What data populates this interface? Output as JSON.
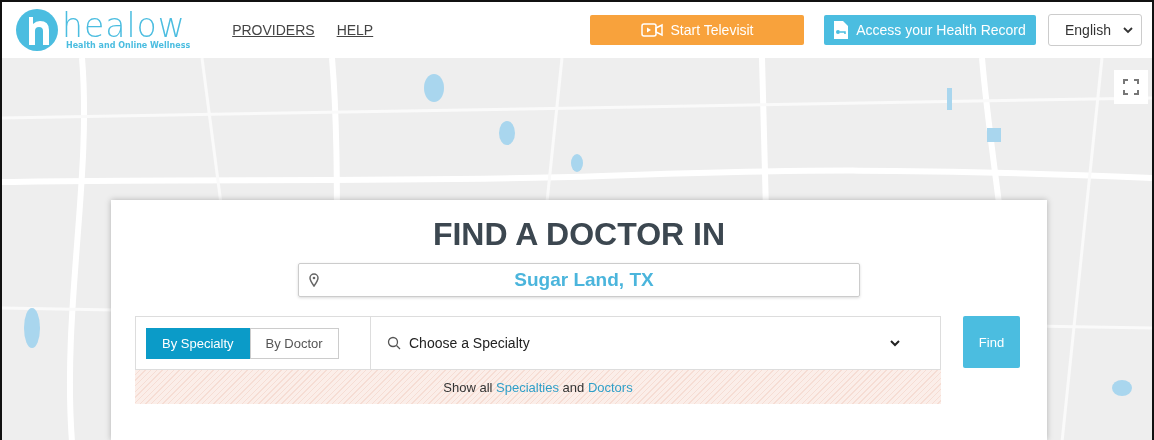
{
  "header": {
    "logo": {
      "name": "healow",
      "tagline": "Health and Online Wellness"
    },
    "nav": [
      "PROVIDERS",
      "HELP"
    ],
    "televisit_button": "Start Televisit",
    "health_record_button": "Access your Health Record",
    "language": "English"
  },
  "search_card": {
    "title": "FIND A DOCTOR IN",
    "location": "Sugar Land, TX",
    "tabs": [
      {
        "label": "By Specialty",
        "selected": true
      },
      {
        "label": "By Doctor",
        "selected": false
      }
    ],
    "specialty_placeholder": "Choose a Specialty",
    "find_button": "Find",
    "show_all": {
      "prefix": "Show all",
      "link_1": "Specialties",
      "middle": "and",
      "link_2": "Doctors"
    }
  }
}
